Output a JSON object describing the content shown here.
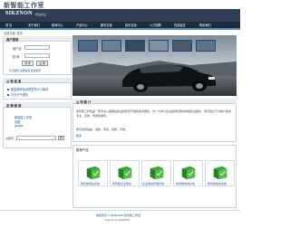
{
  "header": {
    "site_title": "新智能工作室",
    "logo_text": "SIKZNON",
    "logo_sub": "网站建设"
  },
  "nav": {
    "items": [
      "首 页",
      "关于我们",
      "新闻中心",
      "产品中心",
      "解决方案",
      "技术支持",
      "人才招聘",
      "在线留言",
      "联系我们"
    ]
  },
  "breadcrumb": "当前位置: 首页",
  "login": {
    "title": "用户登录",
    "username_label": "用户名:",
    "password_label": "密 码:",
    "login_button": "登 录",
    "register_button": "注 册",
    "forgot_link": "忘记密码 注册会员 找回密码"
  },
  "news_panel": {
    "title": "公 告 信 息",
    "items": [
      "新智能网站系统发布V1.0版本",
      "今天天气很好"
    ]
  },
  "links_panel": {
    "title": "友 情 链 接",
    "items": [
      "新智能工作室",
      "百度",
      "google"
    ],
    "search_label": "关键字:",
    "search_button": "搜"
  },
  "about_panel": {
    "title": "公 司 简 介",
    "paragraph1": "新智能工作室是一家专业从事网站建设和软件开发的技术团队，为广大中小企业提供优质的网站建设服务，我们致力于为客户提供专业、高效、优质的服务。",
    "paragraph2": "我们的宗旨是：诚信、务实、创新、高效。",
    "more": "更多"
  },
  "products_panel": {
    "title": "推荐产品",
    "items": [
      {
        "caption": "新智能网站系统"
      },
      {
        "caption": "新智能企业网站"
      },
      {
        "caption": "企业网站管理系统"
      },
      {
        "caption": "新智能商城系统"
      },
      {
        "caption": "新智能留言系统"
      }
    ]
  },
  "footer": {
    "line1": "版权所有 © 2008-2010 新智能工作室",
    "line2": "Powered by SIKZNON"
  },
  "colors": {
    "accent": "#4e8fbf",
    "header_bg": "#2e3f55",
    "nav_bg": "#1e2c40",
    "link": "#1c4f9c"
  }
}
